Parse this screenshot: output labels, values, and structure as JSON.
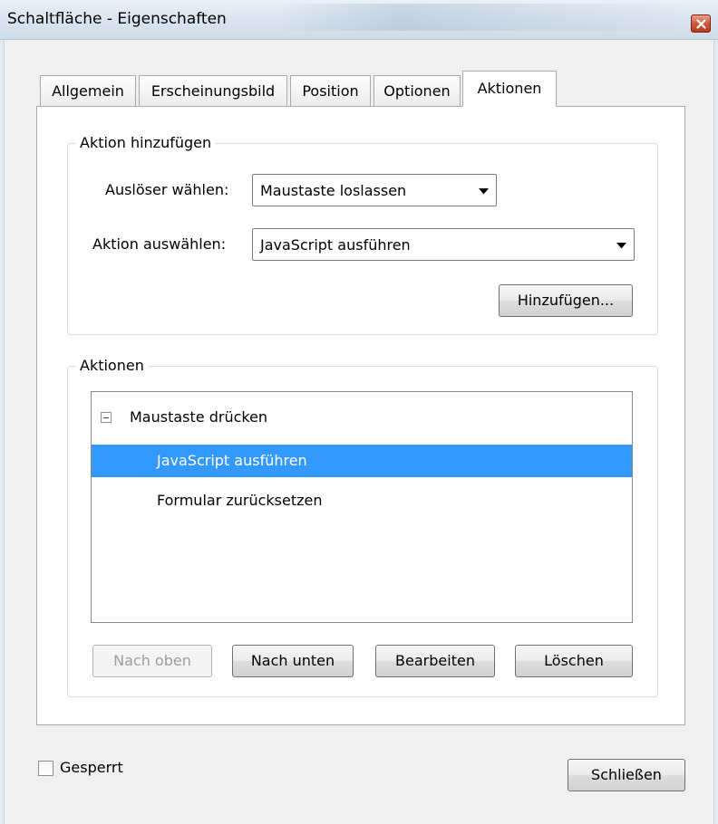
{
  "window": {
    "title": "Schaltfläche - Eigenschaften"
  },
  "tabs": [
    {
      "label": "Allgemein"
    },
    {
      "label": "Erscheinungsbild"
    },
    {
      "label": "Position"
    },
    {
      "label": "Optionen"
    },
    {
      "label": "Aktionen"
    }
  ],
  "active_tab": "Aktionen",
  "add_action": {
    "legend": "Aktion hinzufügen",
    "trigger_label": "Auslöser wählen:",
    "trigger_value": "Maustaste loslassen",
    "action_label": "Aktion auswählen:",
    "action_value": "JavaScript ausführen",
    "add_button": "Hinzufügen..."
  },
  "actions": {
    "legend": "Aktionen",
    "tree": {
      "parent": "Maustaste drücken",
      "children": [
        {
          "label": "JavaScript ausführen",
          "selected": true
        },
        {
          "label": "Formular zurücksetzen",
          "selected": false
        }
      ]
    },
    "buttons": {
      "up": "Nach oben",
      "down": "Nach unten",
      "edit": "Bearbeiten",
      "delete": "Löschen"
    }
  },
  "footer": {
    "locked_label": "Gesperrt",
    "locked_checked": false,
    "close_button": "Schließen"
  },
  "colors": {
    "selection": "#3399ff",
    "close_button": "#c8452a"
  }
}
